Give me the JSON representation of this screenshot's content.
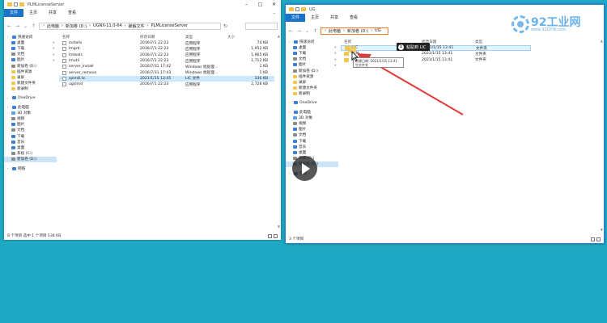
{
  "left_window": {
    "title": "PLMLicenseServer",
    "ribbon_tabs": [
      "文件",
      "主页",
      "共享",
      "查看"
    ],
    "address": [
      "此电脑",
      "新加卷 (D:)",
      "UGNX-11.0-64",
      "破解文件",
      "PLMLicenseServer"
    ],
    "nav": [
      {
        "label": "快速访问",
        "icon_color": "#3b7fd6",
        "pin": false,
        "level": 0
      },
      {
        "label": "桌面",
        "icon_color": "#3b7fd6",
        "pin": true,
        "level": 1
      },
      {
        "label": "下载",
        "icon_color": "#3b7fd6",
        "pin": true,
        "level": 1
      },
      {
        "label": "文档",
        "icon_color": "#8a8a8a",
        "pin": true,
        "level": 1
      },
      {
        "label": "图片",
        "icon_color": "#3b7fd6",
        "pin": true,
        "level": 1
      },
      {
        "label": "新加卷 (D:)",
        "icon_color": "#8a8a8a",
        "pin": false,
        "level": 1
      },
      {
        "label": "插件资源",
        "icon_color": "#f5c64a",
        "pin": false,
        "level": 1
      },
      {
        "label": "录屏",
        "icon_color": "#f5c64a",
        "pin": false,
        "level": 1
      },
      {
        "label": "新建文件夹",
        "icon_color": "#f5c64a",
        "pin": false,
        "level": 1
      },
      {
        "label": "新录制",
        "icon_color": "#f5c64a",
        "pin": false,
        "level": 1
      },
      {
        "label": "OneDrive",
        "icon_color": "#3b7fd6",
        "pin": false,
        "level": 0,
        "gap": true
      },
      {
        "label": "此电脑",
        "icon_color": "#3b7fd6",
        "pin": false,
        "level": 0,
        "gap": true
      },
      {
        "label": "3D 对象",
        "icon_color": "#5aa0e0",
        "pin": false,
        "level": 1
      },
      {
        "label": "视频",
        "icon_color": "#8a8a8a",
        "pin": false,
        "level": 1
      },
      {
        "label": "图片",
        "icon_color": "#3b7fd6",
        "pin": false,
        "level": 1
      },
      {
        "label": "文档",
        "icon_color": "#8a8a8a",
        "pin": false,
        "level": 1
      },
      {
        "label": "下载",
        "icon_color": "#3b7fd6",
        "pin": false,
        "level": 1
      },
      {
        "label": "音乐",
        "icon_color": "#3b7fd6",
        "pin": false,
        "level": 1
      },
      {
        "label": "桌面",
        "icon_color": "#3b7fd6",
        "pin": false,
        "level": 1
      },
      {
        "label": "系统 (C:)",
        "icon_color": "#8a8a8a",
        "pin": false,
        "level": 1
      },
      {
        "label": "新加卷 (D:)",
        "icon_color": "#8a8a8a",
        "pin": false,
        "level": 1,
        "selected": true
      },
      {
        "label": "网络",
        "icon_color": "#3b7fd6",
        "pin": false,
        "level": 0,
        "gap": true
      }
    ],
    "columns": [
      "名称",
      "修改日期",
      "类型",
      "大小"
    ],
    "files": [
      {
        "name": "installs",
        "date": "2016/7/1 22:23",
        "type": "应用程序",
        "size": "74 KB"
      },
      {
        "name": "lmgrd",
        "date": "2016/7/1 22:23",
        "type": "应用程序",
        "size": "1,952 KB"
      },
      {
        "name": "lmtools",
        "date": "2016/7/1 22:23",
        "type": "应用程序",
        "size": "1,965 KB"
      },
      {
        "name": "lmutil",
        "date": "2016/7/1 22:23",
        "type": "应用程序",
        "size": "1,712 KB"
      },
      {
        "name": "server_install",
        "date": "2016/7/31 17:42",
        "type": "Windows 批处理...",
        "size": "1 KB"
      },
      {
        "name": "server_remove",
        "date": "2016/7/31 17:43",
        "type": "Windows 批处理...",
        "size": "1 KB"
      },
      {
        "name": "splm8.lic",
        "date": "2021/1/15 13:45",
        "type": "LIC 文件",
        "size": "336 KB",
        "selected": true
      },
      {
        "name": "ugslmd",
        "date": "2016/7/1 22:23",
        "type": "应用程序",
        "size": "2,728 KB"
      }
    ],
    "status": "8 个项目   选中 1 个项目 538 KB"
  },
  "right_window": {
    "title": "UG",
    "ribbon_tabs": [
      "文件",
      "主页",
      "共享",
      "查看"
    ],
    "address": [
      "此电脑",
      "新加卷 (D:)",
      "UG"
    ],
    "nav": [
      {
        "label": "快速访问",
        "icon_color": "#3b7fd6",
        "pin": false,
        "level": 0
      },
      {
        "label": "桌面",
        "icon_color": "#3b7fd6",
        "pin": true,
        "level": 1
      },
      {
        "label": "下载",
        "icon_color": "#3b7fd6",
        "pin": true,
        "level": 1
      },
      {
        "label": "文档",
        "icon_color": "#8a8a8a",
        "pin": true,
        "level": 1
      },
      {
        "label": "图片",
        "icon_color": "#3b7fd6",
        "pin": true,
        "level": 1
      },
      {
        "label": "新加卷 (D:)",
        "icon_color": "#8a8a8a",
        "pin": false,
        "level": 1
      },
      {
        "label": "插件资源",
        "icon_color": "#f5c64a",
        "pin": false,
        "level": 1
      },
      {
        "label": "录屏",
        "icon_color": "#f5c64a",
        "pin": false,
        "level": 1
      },
      {
        "label": "新建文件夹",
        "icon_color": "#f5c64a",
        "pin": false,
        "level": 1
      },
      {
        "label": "新录制",
        "icon_color": "#f5c64a",
        "pin": false,
        "level": 1
      },
      {
        "label": "OneDrive",
        "icon_color": "#3b7fd6",
        "pin": false,
        "level": 0,
        "gap": true
      },
      {
        "label": "此电脑",
        "icon_color": "#3b7fd6",
        "pin": false,
        "level": 0,
        "gap": true
      },
      {
        "label": "3D 对象",
        "icon_color": "#5aa0e0",
        "pin": false,
        "level": 1
      },
      {
        "label": "视频",
        "icon_color": "#8a8a8a",
        "pin": false,
        "level": 1
      },
      {
        "label": "图片",
        "icon_color": "#3b7fd6",
        "pin": false,
        "level": 1
      },
      {
        "label": "文档",
        "icon_color": "#8a8a8a",
        "pin": false,
        "level": 1
      },
      {
        "label": "下载",
        "icon_color": "#3b7fd6",
        "pin": false,
        "level": 1
      },
      {
        "label": "音乐",
        "icon_color": "#3b7fd6",
        "pin": false,
        "level": 1
      },
      {
        "label": "桌面",
        "icon_color": "#3b7fd6",
        "pin": false,
        "level": 1
      },
      {
        "label": "系统 (C:)",
        "icon_color": "#8a8a8a",
        "pin": false,
        "level": 1
      },
      {
        "label": "新加卷 (D:)",
        "icon_color": "#8a8a8a",
        "pin": false,
        "level": 1,
        "selected": true
      },
      {
        "label": "网络",
        "icon_color": "#3b7fd6",
        "pin": false,
        "level": 0,
        "gap": true
      }
    ],
    "columns": [
      "名称",
      "修改日期",
      "类型"
    ],
    "files": [
      {
        "name": "LIC",
        "date": "2021/1/15 13:41",
        "type": "文件夹",
        "hover": true
      },
      {
        "name": "PLM",
        "date": "2021/1/15 13:41",
        "type": "文件夹"
      },
      {
        "name": "UG",
        "date": "2021/1/15 13:41",
        "type": "文件夹"
      }
    ],
    "status": "3 个项目"
  },
  "overlay": {
    "paste_tip_number": "1",
    "paste_tip": "粘贴到 LIC",
    "drag_tooltip_line1": "创建日期: 2021/1/15 13:41",
    "drag_tooltip_line2": "空文件夹",
    "logo_big": "92工业网",
    "logo_small": "www.92GYW.com"
  },
  "colors": {
    "desktop": "#1ea8c4",
    "address_highlight": "#f07d2e",
    "arrow": "#e03a3a",
    "logo": "#6cb2ea"
  }
}
